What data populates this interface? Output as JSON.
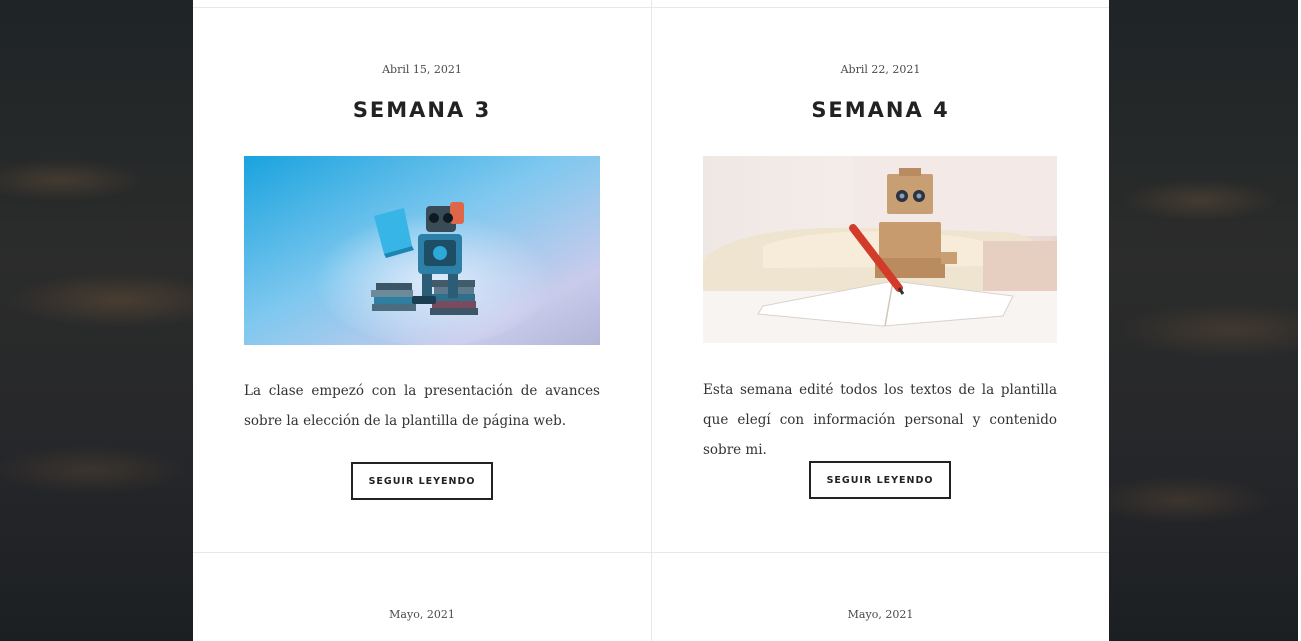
{
  "posts": [
    {
      "date": "Abril 15, 2021",
      "title": "SEMANA 3",
      "image": "robot-reading-book-on-blue",
      "excerpt": "La clase empezó con la presentación de avances sobre la elección de la plantilla de página web.",
      "button_label": "SEGUIR LEYENDO"
    },
    {
      "date": "Abril 22, 2021",
      "title": "SEMANA 4",
      "image": "cardboard-robot-writing-notebook",
      "excerpt": "Esta semana edité todos los textos de la plantilla que elegí con información personal y contenido sobre mi.",
      "button_label": "SEGUIR LEYENDO"
    },
    {
      "date": "Mayo, 2021"
    },
    {
      "date": "Mayo, 2021"
    }
  ],
  "colors": {
    "card_background": "#ffffff",
    "text": "#333333",
    "title": "#222222",
    "divider": "#e8e8e8"
  }
}
